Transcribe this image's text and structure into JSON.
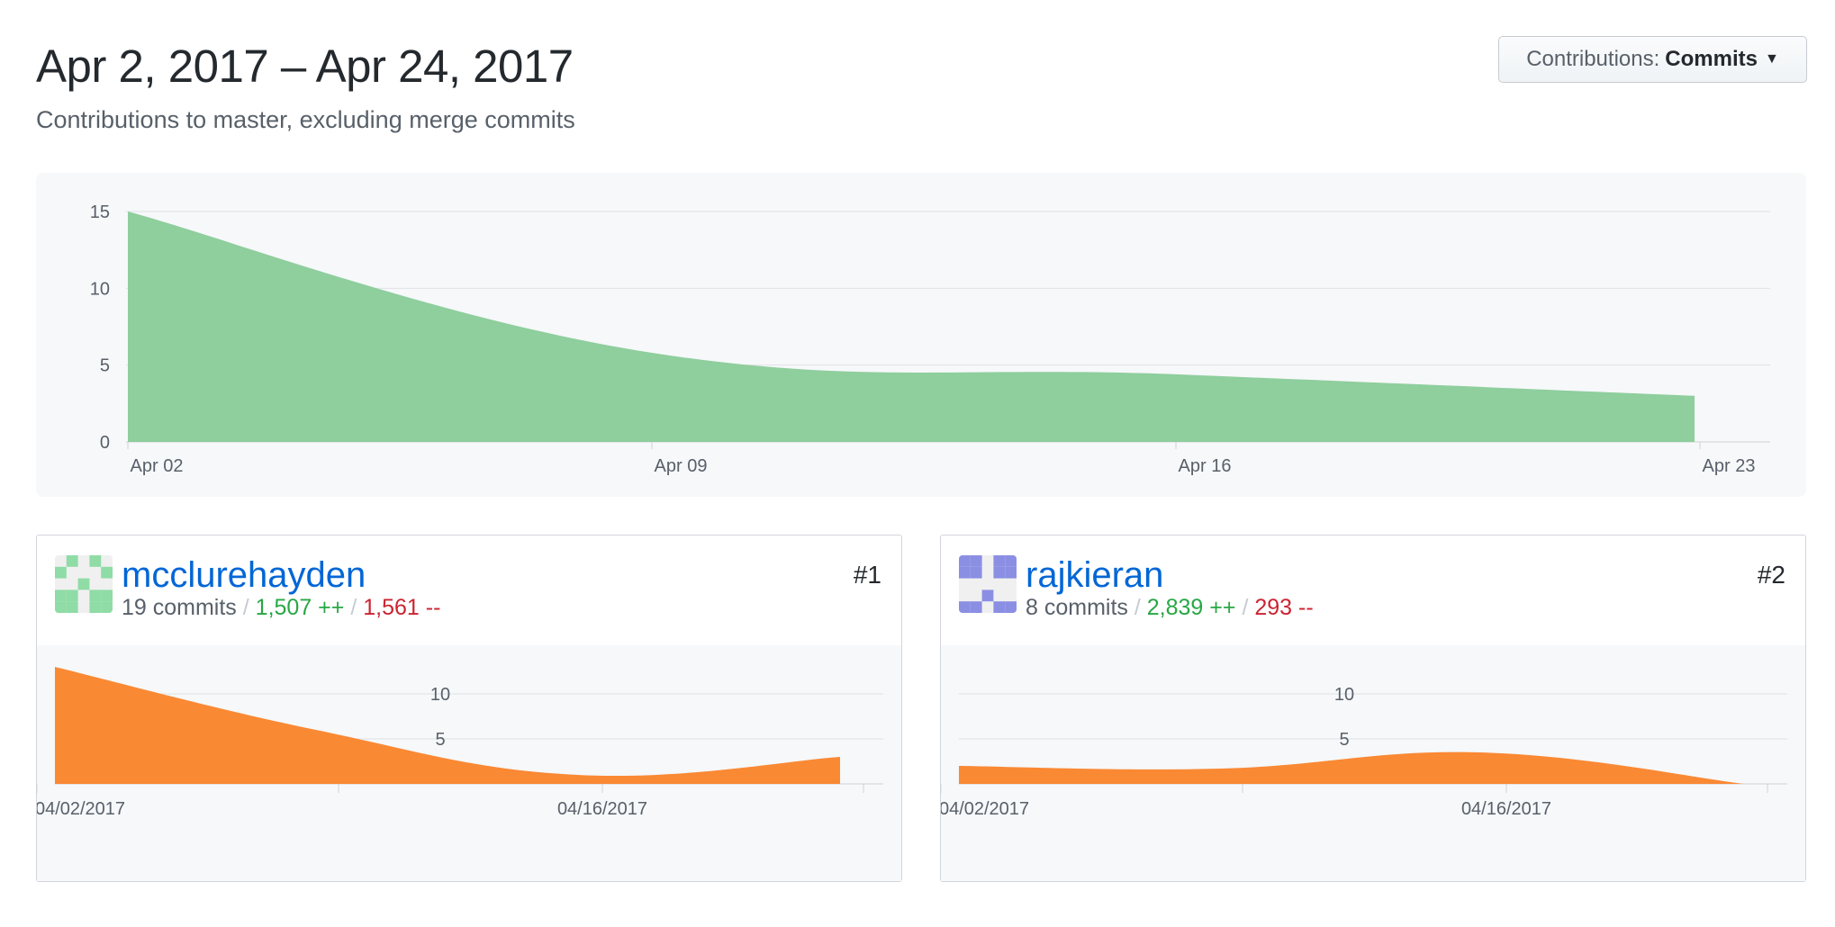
{
  "header": {
    "title": "Apr 2, 2017 – Apr 24, 2017",
    "subtitle": "Contributions to master, excluding merge commits"
  },
  "contributions_button": {
    "label": "Contributions:",
    "value": "Commits"
  },
  "chart_data": [
    {
      "type": "area",
      "title": "",
      "x": [
        "2017-04-02",
        "2017-04-09",
        "2017-04-16",
        "2017-04-23"
      ],
      "x_tick_labels": [
        "Apr 02",
        "Apr 09",
        "Apr 16",
        "Apr 23"
      ],
      "y_ticks": [
        0,
        5,
        10,
        15
      ],
      "ylim": [
        0,
        15
      ],
      "series": [
        {
          "values": [
            15,
            5.8,
            4.4,
            3.0
          ]
        }
      ],
      "color": "#8fce9d",
      "grid": true
    },
    {
      "type": "area",
      "x_tick_labels": [
        "04/02/2017",
        "04/16/2017"
      ],
      "y_ticks": [
        5,
        10
      ],
      "series": [
        {
          "values": [
            13,
            6,
            1,
            3
          ]
        }
      ],
      "color": "#fa8934",
      "grid": true
    },
    {
      "type": "area",
      "x_tick_labels": [
        "04/02/2017",
        "04/16/2017"
      ],
      "y_ticks": [
        5,
        10
      ],
      "series": [
        {
          "values": [
            2,
            1.7,
            3.5,
            0
          ]
        }
      ],
      "color": "#fa8934",
      "grid": true
    }
  ],
  "contributors": [
    {
      "username": "mcclurehayden",
      "rank": "#1",
      "commits": "19 commits",
      "additions": "1,507 ++",
      "deletions": "1,561 --",
      "avatar_color": "#8fdca6"
    },
    {
      "username": "rajkieran",
      "rank": "#2",
      "commits": "8 commits",
      "additions": "2,839 ++",
      "deletions": "293 --",
      "avatar_color": "#8b8fe3"
    }
  ]
}
